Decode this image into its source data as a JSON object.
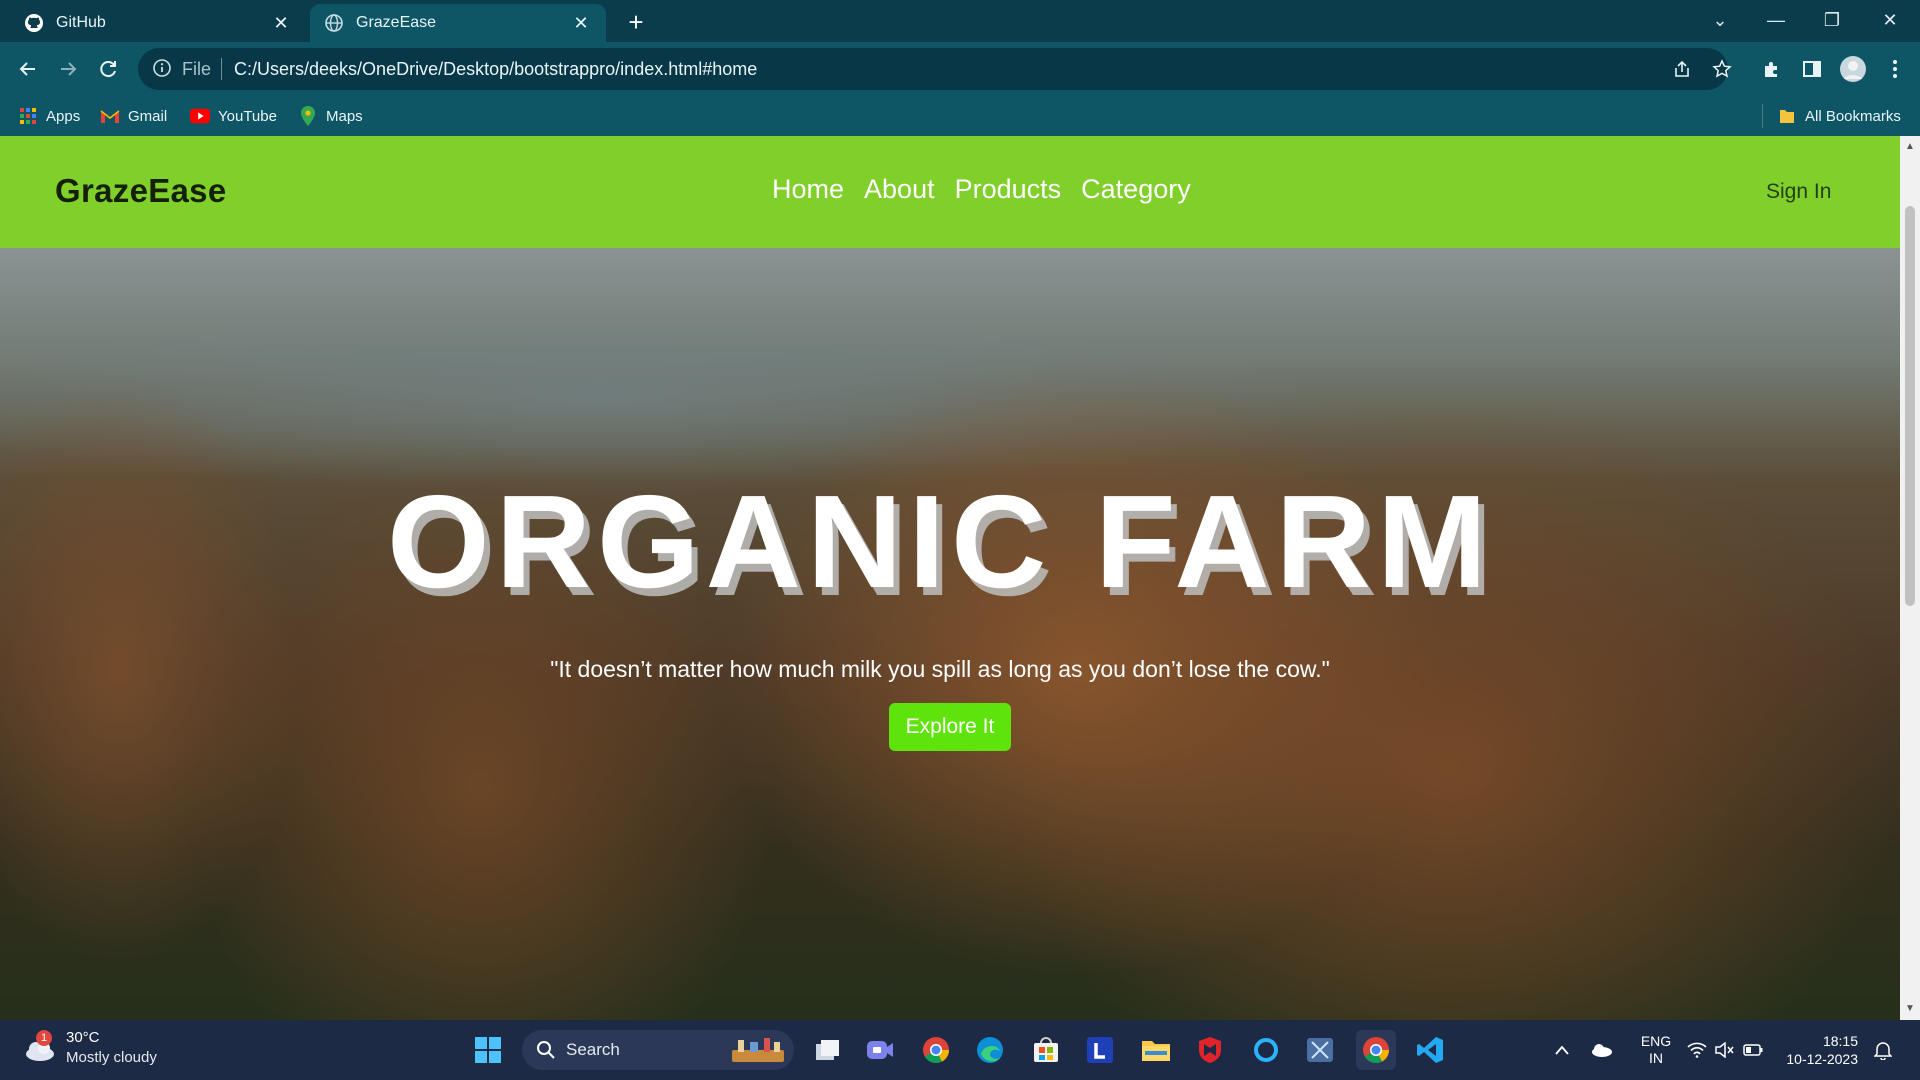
{
  "browser": {
    "tabs": [
      {
        "title": "GitHub",
        "icon": "github-icon",
        "active": false
      },
      {
        "title": "GrazeEase",
        "icon": "globe-icon",
        "active": true
      }
    ],
    "omnibox": {
      "scheme": "File",
      "url": "C:/Users/deeks/OneDrive/Desktop/bootstrappro/index.html#home"
    },
    "bookmarks": [
      {
        "label": "Apps",
        "icon": "apps-grid-icon"
      },
      {
        "label": "Gmail",
        "icon": "gmail-icon"
      },
      {
        "label": "YouTube",
        "icon": "youtube-icon"
      },
      {
        "label": "Maps",
        "icon": "maps-icon"
      }
    ],
    "all_bookmarks_label": "All Bookmarks"
  },
  "site": {
    "brand": "GrazeEase",
    "nav": [
      "Home",
      "About",
      "Products",
      "Category"
    ],
    "sign_in": "Sign In",
    "accent_color": "#80cf2a",
    "hero": {
      "title": "ORGANIC FARM",
      "quote": "\"It doesn’t matter how much milk you spill as long as you don’t lose the cow.\"",
      "button": "Explore It",
      "button_color": "#5ee40a"
    }
  },
  "taskbar": {
    "weather": {
      "temp": "30°C",
      "desc": "Mostly cloudy",
      "badge": "1"
    },
    "search_label": "Search",
    "language": {
      "line1": "ENG",
      "line2": "IN"
    },
    "clock": {
      "time": "18:15",
      "date": "10-12-2023"
    }
  }
}
